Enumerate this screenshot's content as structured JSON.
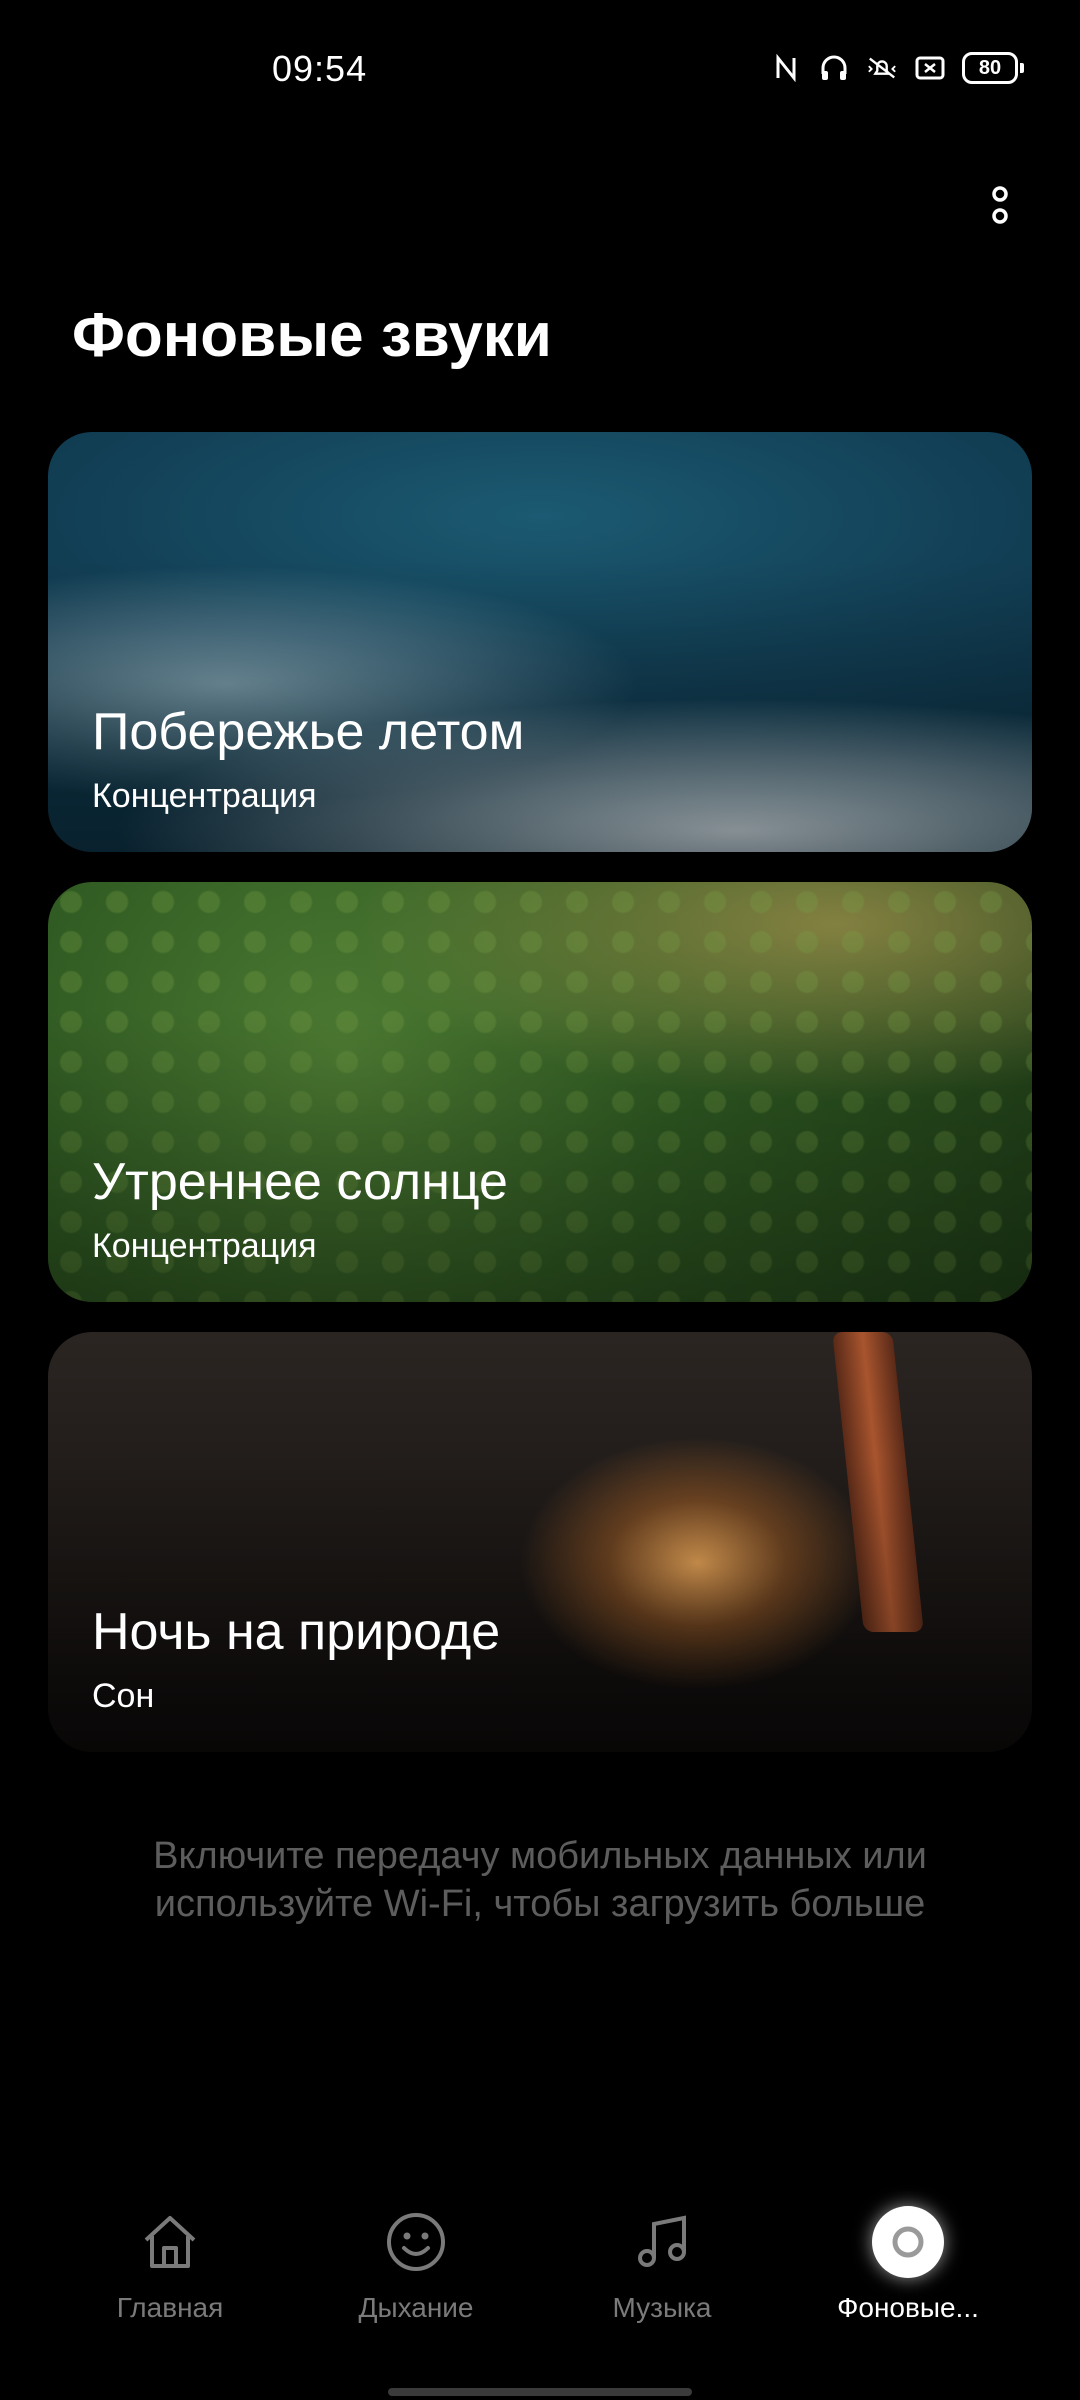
{
  "status_bar": {
    "time": "09:54",
    "battery": "80",
    "icons": [
      "nfc-icon",
      "headphones-icon",
      "vibrate-icon",
      "screen-record-icon",
      "battery-icon"
    ]
  },
  "page": {
    "title": "Фоновые звуки"
  },
  "cards": [
    {
      "title": "Побережье летом",
      "category": "Концентрация"
    },
    {
      "title": "Утреннее солнце",
      "category": "Концентрация"
    },
    {
      "title": "Ночь на природе",
      "category": "Сон"
    }
  ],
  "hint": {
    "line1": "Включите передачу мобильных данных или",
    "line2": "используйте Wi-Fi, чтобы загрузить больше"
  },
  "bottom_nav": {
    "items": [
      {
        "label": "Главная",
        "icon": "home-icon"
      },
      {
        "label": "Дыхание",
        "icon": "smile-icon"
      },
      {
        "label": "Музыка",
        "icon": "music-note-icon"
      },
      {
        "label": "Фоновые...",
        "icon": "ring-icon"
      }
    ],
    "active_index": 3
  },
  "colors": {
    "background": "#000000",
    "hint_text": "#5d5d5d",
    "inactive_nav": "#7a7a7a"
  }
}
